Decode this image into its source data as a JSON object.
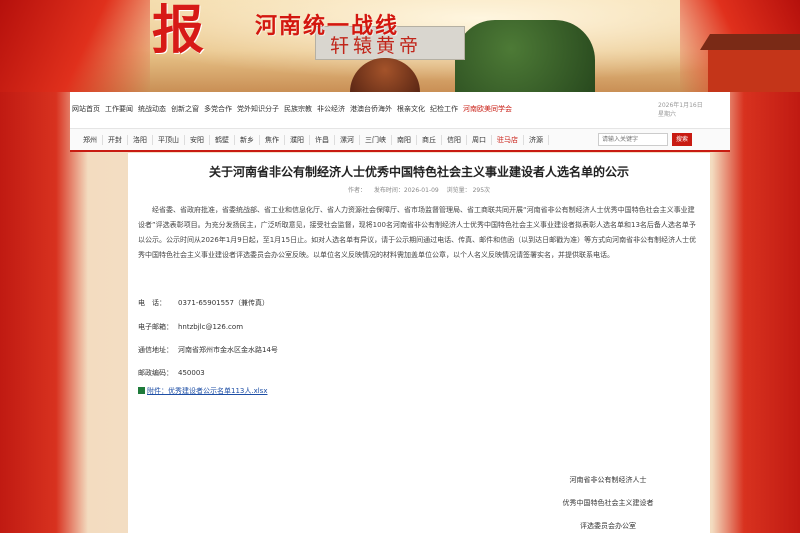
{
  "banner": {
    "big_char": "报",
    "site_name": "河南统一战线",
    "monument_text": "轩辕黄帝"
  },
  "nav1": {
    "links": [
      "网站首页",
      "工作要闻",
      "统战动态",
      "创新之窗",
      "多党合作",
      "党外知识分子",
      "民族宗教",
      "非公经济",
      "港澳台侨海外",
      "根亲文化",
      "纪检工作",
      "河南欧美同学会"
    ],
    "active_index": 11,
    "date": "2026年1月16日",
    "weekday": "星期六"
  },
  "nav2": {
    "cities": [
      "郑州",
      "开封",
      "洛阳",
      "平顶山",
      "安阳",
      "鹤壁",
      "新乡",
      "焦作",
      "濮阳",
      "许昌",
      "漯河",
      "三门峡",
      "南阳",
      "商丘",
      "信阳",
      "周口",
      "驻马店",
      "济源"
    ],
    "active_index": 16,
    "search_placeholder": "请输入关键字",
    "search_button": "搜索"
  },
  "article": {
    "title": "关于河南省非公有制经济人士优秀中国特色社会主义事业建设者人选名单的公示",
    "author": "作者：",
    "date": "发布时间：2026-01-09",
    "views": "浏览量：   295次",
    "paragraph": "经省委、省政府批准，省委统战部、省工业和信息化厅、省人力资源社会保障厅、省市场监督管理局、省工商联共同开展“河南省非公有制经济人士优秀中国特色社会主义事业建设者”评选表彰项目。为充分发扬民主，广泛听取意见，接受社会监督，现将100名河南省非公有制经济人士优秀中国特色社会主义事业建设者拟表彰人选名单和13名后备人选名单予以公示。公示时间从2026年1月9日起，至1月15日止。如对人选名单有异议，请于公示期间通过电话、传真、邮件和信函（以到达日邮戳为准）等方式向河南省非公有制经济人士优秀中国特色社会主义事业建设者评选委员会办公室反映。以单位名义反映情况的材料需加盖单位公章，以个人名义反映情况请签署实名，并提供联系电话。",
    "phone_label": "电　话：",
    "phone": "0371-65901557（兼传真）",
    "email_label": "电子邮箱：",
    "email": "hntzbjlc@126.com",
    "address_label": "通信地址：",
    "address": "河南省郑州市金水区金水路14号",
    "zip_label": "邮政编码：",
    "zip": "450003",
    "attachment": "附件：优秀建设者公示名单113人.xlsx",
    "sign_lines": [
      "河南省非公有制经济人士",
      "优秀中国特色社会主义建设者",
      "评选委员会办公室"
    ]
  }
}
